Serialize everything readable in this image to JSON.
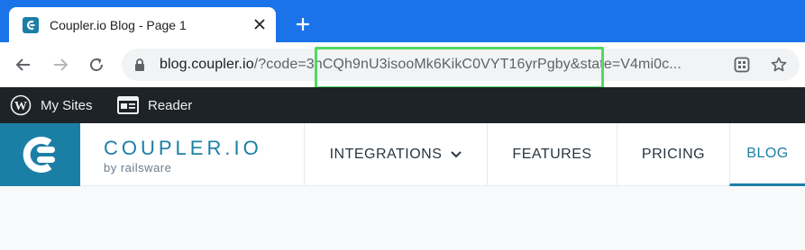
{
  "browser": {
    "tab": {
      "title": "Coupler.io Blog - Page 1",
      "favicon": "coupler-favicon-icon"
    },
    "new_tab_icon": "plus-icon",
    "address": {
      "host": "blog.coupler.io",
      "rest": "/?code=3hCQh9nU3isooMk6KikC0VYT16yrPgby&state=V4mi0c...",
      "highlight_color": "#4ddb62"
    },
    "colors": {
      "tabstrip": "#1a73e8"
    }
  },
  "wp_admin_bar": {
    "items": [
      {
        "label": "My Sites",
        "icon": "wordpress-icon"
      },
      {
        "label": "Reader",
        "icon": "reader-icon"
      }
    ]
  },
  "site": {
    "brand": {
      "name": "COUPLER.IO",
      "sub": "by railsware"
    },
    "nav": [
      {
        "label": "INTEGRATIONS",
        "has_dropdown": true
      },
      {
        "label": "FEATURES"
      },
      {
        "label": "PRICING"
      },
      {
        "label": "BLOG",
        "active": true
      }
    ],
    "colors": {
      "accent": "#1b7fa5"
    }
  }
}
